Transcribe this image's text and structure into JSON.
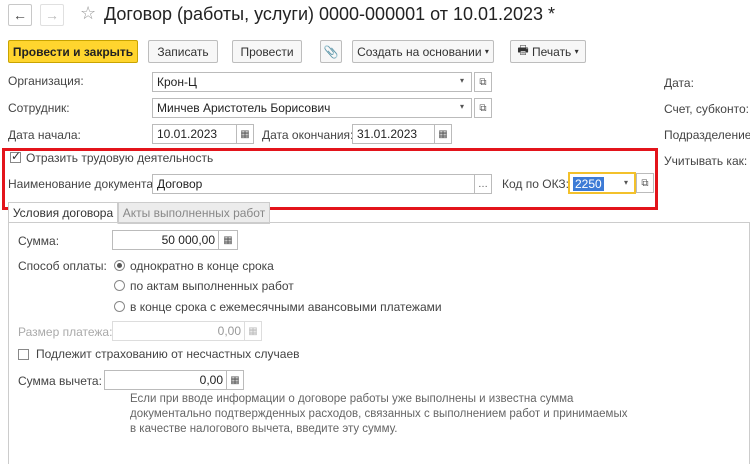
{
  "window": {
    "title": "Договор (работы, услуги) 0000-000001 от 10.01.2023 *"
  },
  "toolbar": {
    "post_close": "Провести и закрыть",
    "save": "Записать",
    "post": "Провести",
    "create_based": "Создать на основании",
    "print": "Печать"
  },
  "form": {
    "org_label": "Организация:",
    "org_value": "Крон-Ц",
    "employee_label": "Сотрудник:",
    "employee_value": "Минчев Аристотель Борисович",
    "start_label": "Дата начала:",
    "start_value": "10.01.2023",
    "end_label": "Дата окончания:",
    "end_value": "31.01.2023",
    "right_date": "Дата:",
    "right_account": "Счет, субконто:",
    "right_division": "Подразделение:",
    "right_consider": "Учитывать как:",
    "reflect_label": "Отразить трудовую деятельность",
    "reflect_checked": true,
    "docname_label": "Наименование документа:",
    "docname_value": "Договор",
    "okz_label": "Код по ОКЗ:",
    "okz_value": "2250"
  },
  "tabs": [
    {
      "label": "Условия договора"
    },
    {
      "label": "Акты выполненных работ"
    }
  ],
  "terms": {
    "sum_label": "Сумма:",
    "sum_value": "50 000,00",
    "payment_label": "Способ оплаты:",
    "payment_options": [
      {
        "label": "однократно в конце срока",
        "selected": true
      },
      {
        "label": "по актам выполненных работ",
        "selected": false
      },
      {
        "label": "в конце срока с ежемесячными авансовыми платежами",
        "selected": false
      }
    ],
    "payment_size_label": "Размер платежа:",
    "payment_size_value": "0,00",
    "insurance_label": "Подлежит страхованию от несчастных случаев",
    "deduction_label": "Сумма вычета:",
    "deduction_value": "0,00",
    "hint": "Если при вводе информации о договоре работы уже выполнены и известна сумма документально подтвержденных расходов, связанных с выполнением работ и принимаемых в качестве налогового вычета, введите эту сумму."
  }
}
